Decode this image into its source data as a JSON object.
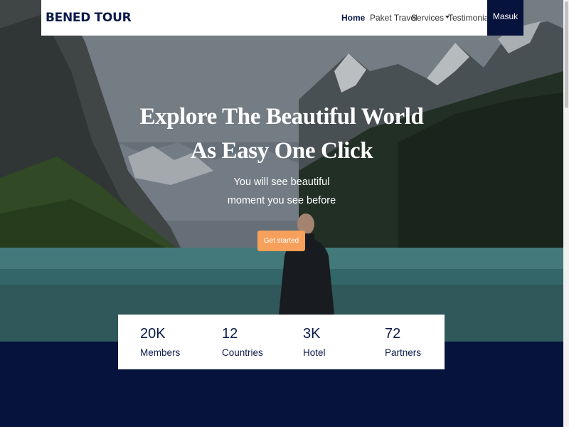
{
  "brand": {
    "name": "BENED TOUR"
  },
  "nav": {
    "home": "Home",
    "paket_travel": "Paket Travel",
    "services": "Services",
    "testimonial": "Testimonial",
    "login": "Masuk"
  },
  "hero": {
    "title_line1": "Explore The Beautiful World",
    "title_line2": "As Easy One Click",
    "subtitle_line1": "You will see beautiful",
    "subtitle_line2": "moment you see before",
    "cta": "Get started"
  },
  "stats": [
    {
      "value": "20K",
      "label": "Members"
    },
    {
      "value": "12",
      "label": "Countries"
    },
    {
      "value": "3K",
      "label": "Hotel"
    },
    {
      "value": "72",
      "label": "Partners"
    }
  ],
  "colors": {
    "navy": "#06133c",
    "accent": "#f7a05b",
    "white": "#ffffff"
  }
}
